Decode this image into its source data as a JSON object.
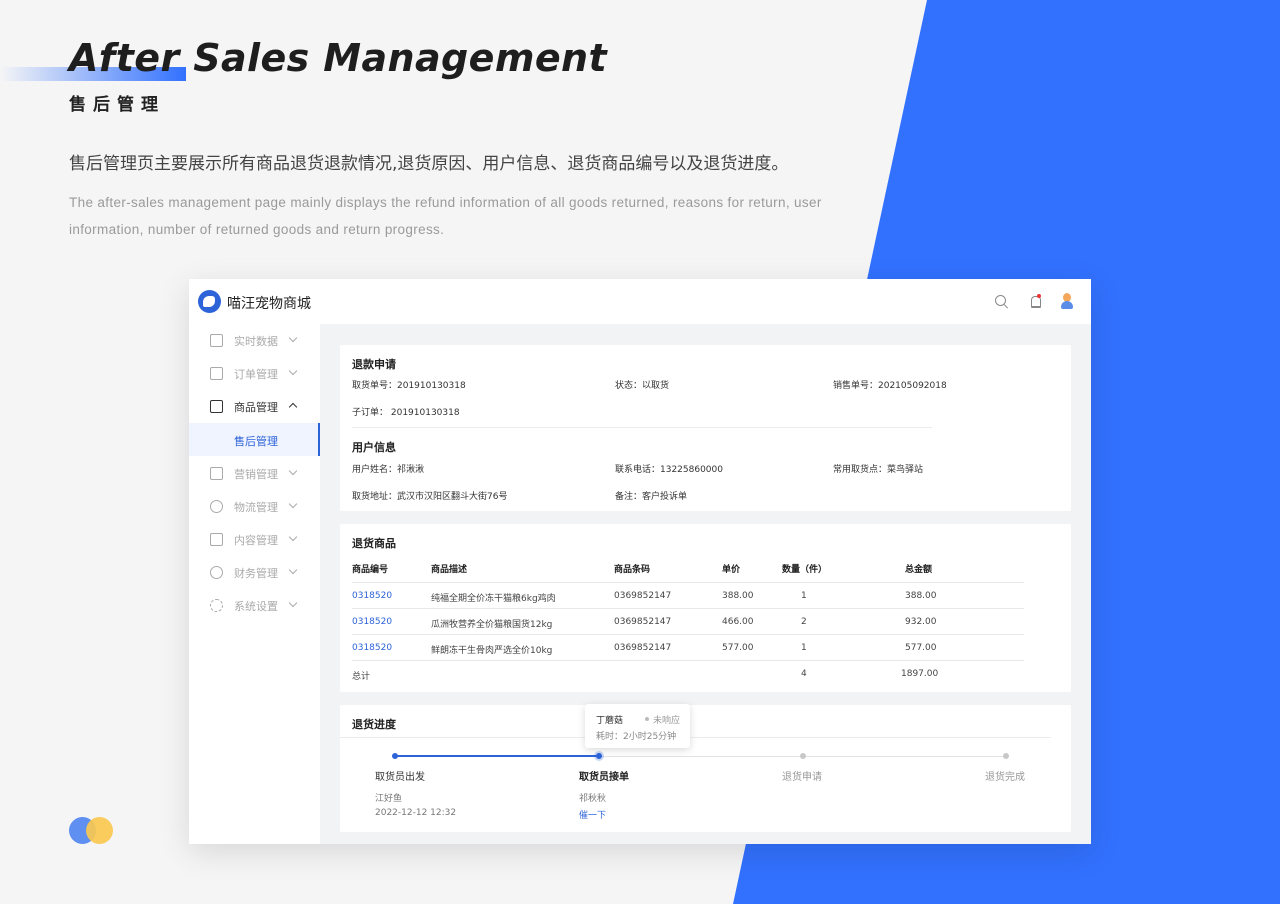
{
  "colors": {
    "accent": "#3271fe",
    "link": "#2d63d8",
    "tooltip_dot": "#bbbbbb"
  },
  "hero": {
    "title_en": "After Sales Management",
    "title_cn": "售后管理",
    "desc_cn": "售后管理页主要展示所有商品退货退款情况,退货原因、用户信息、退货商品编号以及退货进度。",
    "desc_en": "The after-sales management page mainly displays the refund information of all goods returned, reasons for return, user information, number of returned goods and return progress."
  },
  "app": {
    "brand": "喵汪宠物商城",
    "header_icons": [
      "search-icon",
      "bell-icon",
      "avatar"
    ]
  },
  "sidebar": {
    "items": [
      {
        "label": "实时数据",
        "icon": "chart-icon"
      },
      {
        "label": "订单管理",
        "icon": "document-icon"
      },
      {
        "label": "商品管理",
        "icon": "bag-icon",
        "expanded": true
      },
      {
        "label": "营销管理",
        "icon": "presentation-icon"
      },
      {
        "label": "物流管理",
        "icon": "location-icon"
      },
      {
        "label": "内容管理",
        "icon": "file-icon"
      },
      {
        "label": "财务管理",
        "icon": "currency-icon"
      },
      {
        "label": "系统设置",
        "icon": "gear-icon"
      }
    ],
    "sub_item": "售后管理"
  },
  "refund_request": {
    "title": "退款申请",
    "pickup_no": "取货单号：201910130318",
    "status": "状态：以取货",
    "sale_no": "销售单号：202105092018",
    "sub_order": "子订单：   201910130318"
  },
  "user_info": {
    "title": "用户信息",
    "name": "用户姓名：祁湫湫",
    "phone": "联系电话：13225860000",
    "pickup_point": "常用取货点：菜鸟驿站",
    "address": "取货地址：武汉市汉阳区翻斗大街76号",
    "note": "备注：客户投诉单"
  },
  "returned_goods": {
    "title": "退货商品",
    "headers": [
      "商品编号",
      "商品描述",
      "商品条码",
      "单价",
      "数量（件）",
      "总金额"
    ],
    "rows": [
      {
        "id": "0318520",
        "desc": "纯福全期全价冻干猫粮6kg鸡肉",
        "barcode": "0369852147",
        "price": "388.00",
        "qty": "1",
        "total": "388.00"
      },
      {
        "id": "0318520",
        "desc": "瓜洲牧营养全价猫粮国货12kg",
        "barcode": "0369852147",
        "price": "466.00",
        "qty": "2",
        "total": "932.00"
      },
      {
        "id": "0318520",
        "desc": "鲜朗冻干生骨肉严选全价10kg",
        "barcode": "0369852147",
        "price": "577.00",
        "qty": "1",
        "total": "577.00"
      }
    ],
    "summary_label": "总计",
    "summary_qty": "4",
    "summary_total": "1897.00"
  },
  "progress": {
    "title": "退货进度",
    "tooltip": {
      "name": "丁蘑菇",
      "status": "未响应",
      "time": "耗时：2小时25分钟"
    },
    "steps": [
      {
        "label": "取货员出发",
        "person": "江好鱼",
        "time": "2022-12-12   12:32"
      },
      {
        "label": "取货员接单",
        "person": "祁秋秋",
        "link": "催一下"
      },
      {
        "label": "退货申请"
      },
      {
        "label": "退货完成"
      }
    ]
  }
}
